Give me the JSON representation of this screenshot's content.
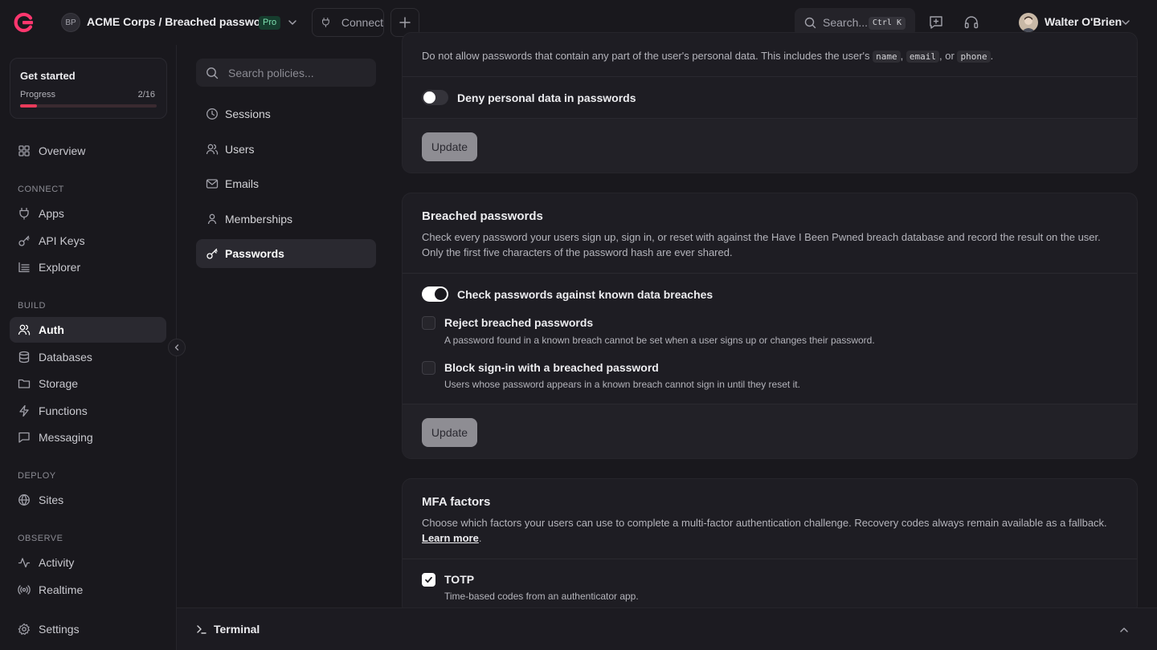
{
  "header": {
    "org_initials": "BP",
    "breadcrumb": "ACME Corps / Breached passwords",
    "plan_badge": "Pro",
    "connect_label": "Connect",
    "search_placeholder": "Search...",
    "search_shortcut": "Ctrl K",
    "user_name": "Walter O'Brien"
  },
  "sidebar": {
    "get_started": {
      "title": "Get started",
      "progress_label": "Progress",
      "progress_count": "2/16",
      "progress_fraction": 0.125
    },
    "overview": "Overview",
    "sections": {
      "connect": "CONNECT",
      "build": "BUILD",
      "deploy": "DEPLOY",
      "observe": "OBSERVE"
    },
    "connect_items": [
      "Apps",
      "API Keys",
      "Explorer"
    ],
    "build_items": [
      "Auth",
      "Databases",
      "Storage",
      "Functions",
      "Messaging"
    ],
    "deploy_items": [
      "Sites"
    ],
    "observe_items": [
      "Activity",
      "Realtime"
    ],
    "settings": "Settings",
    "active_item": "Auth"
  },
  "policies": {
    "search_placeholder": "Search policies...",
    "items": [
      "Sessions",
      "Users",
      "Emails",
      "Memberships",
      "Passwords"
    ],
    "active_item": "Passwords"
  },
  "personal_data_card": {
    "desc_prefix": "Do not allow passwords that contain any part of the user's personal data. This includes the user's",
    "code_name": "name",
    "sep1": ",",
    "code_email": "email",
    "sep2": ", or",
    "code_phone": "phone",
    "desc_suffix": ".",
    "toggle_label": "Deny personal data in passwords",
    "toggle_on": false,
    "update_label": "Update"
  },
  "breached_card": {
    "title": "Breached passwords",
    "description": "Check every password your users sign up, sign in, or reset with against the Have I Been Pwned breach database and record the result on the user. Only the first five characters of the password hash are ever shared.",
    "toggle_label": "Check passwords against known data breaches",
    "toggle_on": true,
    "options": [
      {
        "label": "Reject breached passwords",
        "desc": "A password found in a known breach cannot be set when a user signs up or changes their password.",
        "checked": false
      },
      {
        "label": "Block sign-in with a breached password",
        "desc": "Users whose password appears in a known breach cannot sign in until they reset it.",
        "checked": false
      }
    ],
    "update_label": "Update"
  },
  "mfa_card": {
    "title": "MFA factors",
    "description": "Choose which factors your users can use to complete a multi-factor authentication challenge. Recovery codes always remain available as a fallback.",
    "learn_more": "Learn more",
    "learn_more_suffix": ".",
    "options": [
      {
        "label": "TOTP",
        "desc": "Time-based codes from an authenticator app.",
        "checked": true
      }
    ]
  },
  "terminal": {
    "label": "Terminal"
  },
  "colors": {
    "accent": "#e83b5a",
    "background": "#19181d",
    "card": "#1e1d23",
    "badge_text": "#7ee1b0"
  }
}
